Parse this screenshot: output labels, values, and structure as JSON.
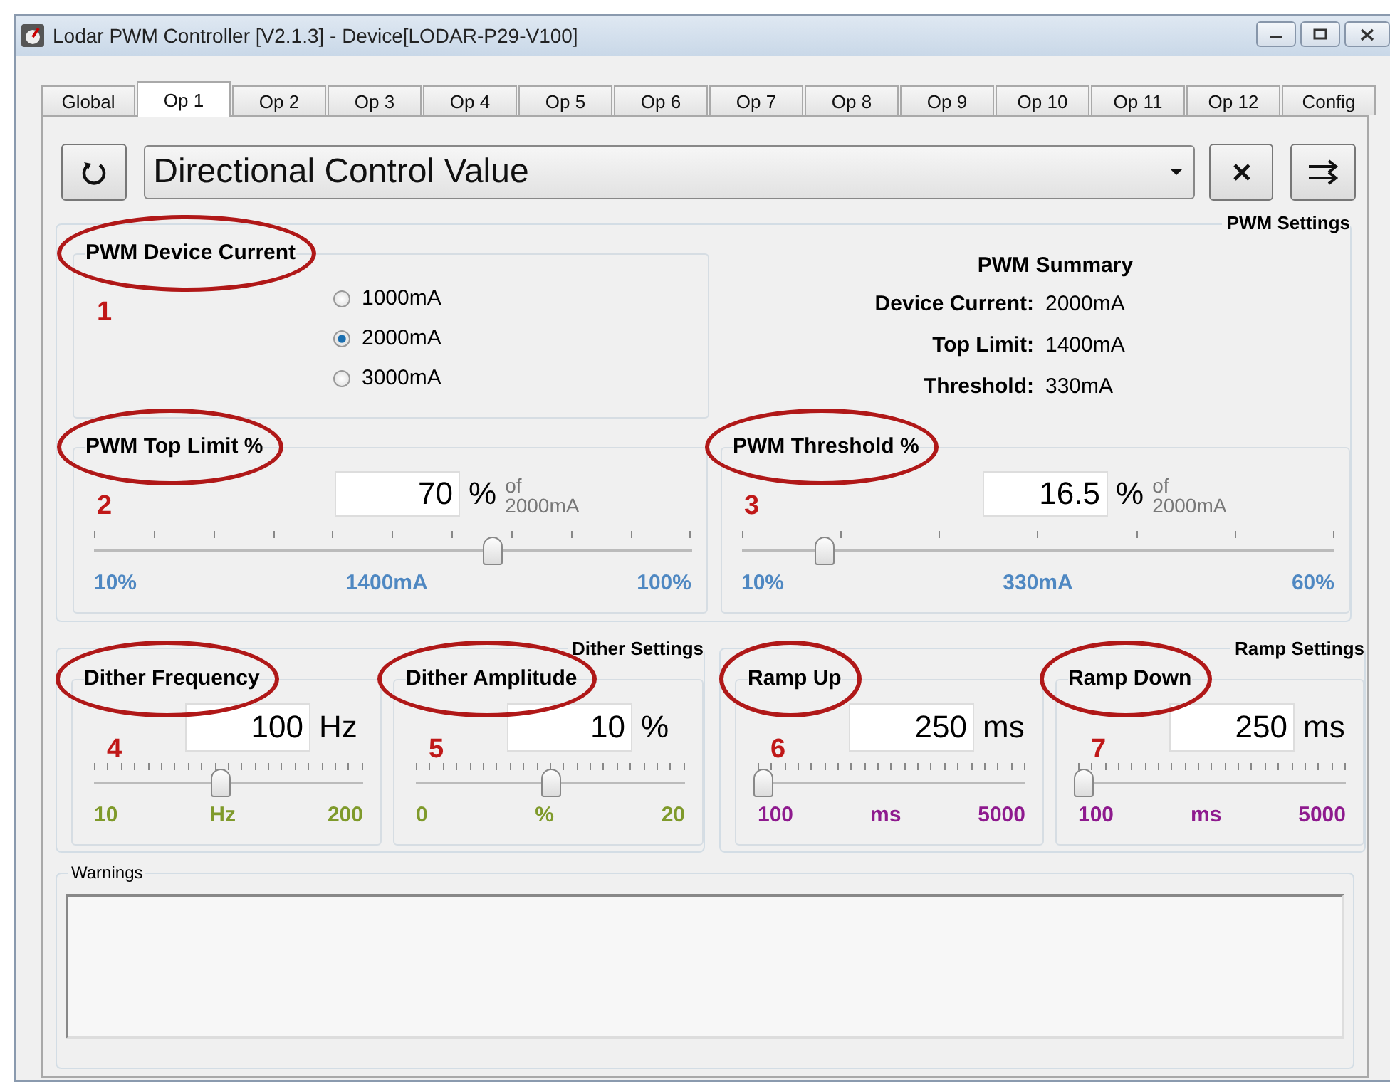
{
  "window": {
    "title": "Lodar PWM Controller [V2.1.3] - Device[LODAR-P29-V100]"
  },
  "tabs": [
    {
      "label": "Global",
      "selected": false
    },
    {
      "label": "Op 1",
      "selected": true
    },
    {
      "label": "Op 2",
      "selected": false
    },
    {
      "label": "Op 3",
      "selected": false
    },
    {
      "label": "Op 4",
      "selected": false
    },
    {
      "label": "Op 5",
      "selected": false
    },
    {
      "label": "Op 6",
      "selected": false
    },
    {
      "label": "Op 7",
      "selected": false
    },
    {
      "label": "Op 8",
      "selected": false
    },
    {
      "label": "Op 9",
      "selected": false
    },
    {
      "label": "Op 10",
      "selected": false
    },
    {
      "label": "Op 11",
      "selected": false
    },
    {
      "label": "Op 12",
      "selected": false
    },
    {
      "label": "Config",
      "selected": false
    }
  ],
  "profile": {
    "value": "Directional Control Value"
  },
  "pwm_settings": {
    "title": "PWM Settings",
    "device_current": {
      "title": "PWM Device Current",
      "circled": true,
      "annotation": "1",
      "options": [
        {
          "label": "1000mA",
          "selected": false
        },
        {
          "label": "2000mA",
          "selected": true
        },
        {
          "label": "3000mA",
          "selected": false
        }
      ]
    },
    "summary": {
      "title": "PWM Summary",
      "rows": [
        {
          "label": "Device Current:",
          "value": "2000mA"
        },
        {
          "label": "Top Limit:",
          "value": "1400mA"
        },
        {
          "label": "Threshold:",
          "value": "330mA"
        }
      ]
    },
    "sliders": [
      {
        "title": "PWM Top Limit %",
        "circled": true,
        "annotation": "2",
        "value": "70",
        "unit": "%",
        "of_label": "of",
        "of_value": "2000mA",
        "level": 0.667,
        "scale": [
          "10%",
          "1400mA",
          "100%"
        ]
      },
      {
        "title": "PWM Threshold %",
        "circled": true,
        "annotation": "3",
        "value": "16.5",
        "unit": "%",
        "of_label": "of",
        "of_value": "2000mA",
        "level": 0.14,
        "scale": [
          "10%",
          "330mA",
          "60%"
        ]
      }
    ]
  },
  "dither_settings": {
    "title": "Dither Settings",
    "controls": [
      {
        "title": "Dither Frequency",
        "circled": true,
        "annotation": "4",
        "value": "100",
        "unit": "Hz",
        "level": 0.47,
        "scale": [
          "10",
          "Hz",
          "200"
        ]
      },
      {
        "title": "Dither Amplitude",
        "circled": true,
        "annotation": "5",
        "value": "10",
        "unit": "%",
        "level": 0.5,
        "scale": [
          "0",
          "%",
          "20"
        ]
      }
    ]
  },
  "ramp_settings": {
    "title": "Ramp Settings",
    "controls": [
      {
        "title": "Ramp Up",
        "circled": true,
        "annotation": "6",
        "value": "250",
        "unit": "ms",
        "level": 0.02,
        "scale": [
          "100",
          "ms",
          "5000"
        ]
      },
      {
        "title": "Ramp Down",
        "circled": true,
        "annotation": "7",
        "value": "250",
        "unit": "ms",
        "level": 0.02,
        "scale": [
          "100",
          "ms",
          "5000"
        ]
      }
    ]
  },
  "warnings": {
    "title": "Warnings"
  }
}
